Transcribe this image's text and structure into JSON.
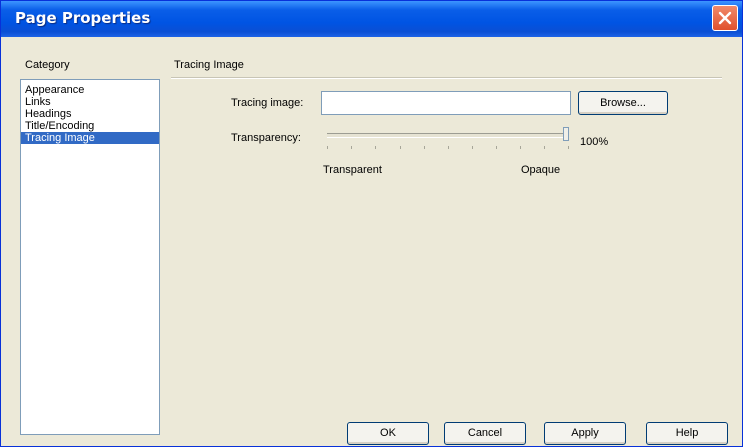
{
  "window": {
    "title": "Page Properties"
  },
  "category": {
    "label": "Category",
    "items": [
      {
        "label": "Appearance",
        "selected": false
      },
      {
        "label": "Links",
        "selected": false
      },
      {
        "label": "Headings",
        "selected": false
      },
      {
        "label": "Title/Encoding",
        "selected": false
      },
      {
        "label": "Tracing Image",
        "selected": true
      }
    ]
  },
  "panel": {
    "section_title": "Tracing Image",
    "tracing_image_label": "Tracing image:",
    "tracing_image_value": "",
    "browse_label": "Browse...",
    "transparency_label": "Transparency:",
    "transparency_value": "100%",
    "transparency_level": 1.0,
    "min_label": "Transparent",
    "max_label": "Opaque"
  },
  "buttons": {
    "ok": "OK",
    "cancel": "Cancel",
    "apply": "Apply",
    "help": "Help"
  },
  "icons": {
    "close": "close-icon"
  },
  "colors": {
    "title_bar": "#0054e3",
    "selection": "#316ac5",
    "close": "#e0502c"
  }
}
